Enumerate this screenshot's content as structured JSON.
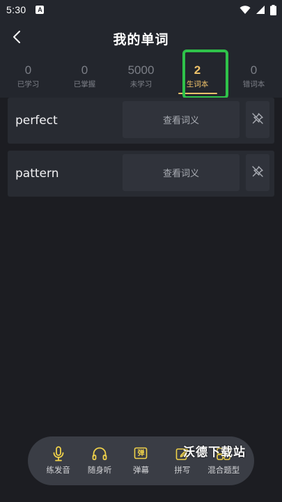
{
  "status_bar": {
    "time": "5:30",
    "app_icon_letter": "A",
    "icons": [
      "wifi-icon",
      "signal-icon",
      "battery-icon"
    ]
  },
  "header": {
    "title": "我的单词",
    "back_icon": "chevron-left-icon"
  },
  "tabs": [
    {
      "count": "0",
      "label": "已学习",
      "active": false
    },
    {
      "count": "0",
      "label": "已掌握",
      "active": false
    },
    {
      "count": "5000",
      "label": "未学习",
      "active": false
    },
    {
      "count": "2",
      "label": "生词本",
      "active": true
    },
    {
      "count": "0",
      "label": "错词本",
      "active": false
    }
  ],
  "words": [
    {
      "word": "perfect",
      "meaning_button": "查看词义",
      "pin_icon": "unpin-icon"
    },
    {
      "word": "pattern",
      "meaning_button": "查看词义",
      "pin_icon": "unpin-icon"
    }
  ],
  "dock": [
    {
      "label": "练发音",
      "icon": "microphone-icon"
    },
    {
      "label": "随身听",
      "icon": "headphones-icon"
    },
    {
      "label": "弹幕",
      "icon": "danmaku-icon",
      "icon_glyph": "弹"
    },
    {
      "label": "拼写",
      "icon": "pencil-icon"
    },
    {
      "label": "混合题型",
      "icon": "mixed-icon"
    }
  ],
  "watermark": "沃德下载站",
  "colors": {
    "accent": "#f0c36b",
    "background": "#1c1d22",
    "card": "#282b32",
    "highlight": "#2fc24a"
  }
}
